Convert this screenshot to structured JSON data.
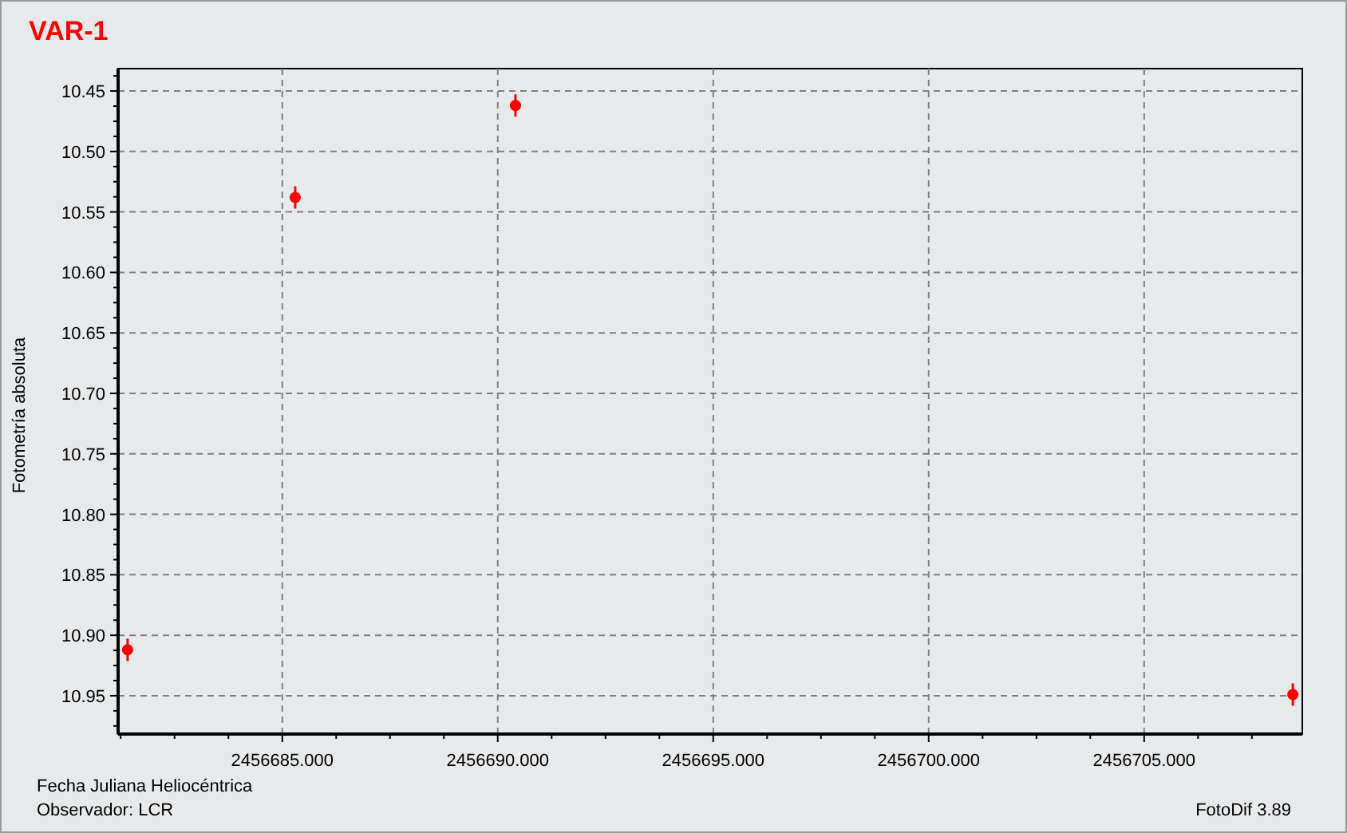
{
  "chart_data": {
    "type": "scatter",
    "grid": true,
    "title": "VAR-1",
    "xlabel": "Fecha Juliana Heliocéntrica",
    "ylabel": "Fotometría absoluta",
    "x": [
      2456681.41,
      2456685.3,
      2456690.41,
      2456708.45
    ],
    "values": [
      10.912,
      10.538,
      10.462,
      10.949
    ],
    "xlim": [
      2456681.19,
      2456708.67
    ],
    "ylim": [
      10.9817,
      10.4315
    ],
    "xticks": [
      {
        "value": 2456685,
        "label": "2456685.000"
      },
      {
        "value": 2456690,
        "label": "2456690.000"
      },
      {
        "value": 2456695,
        "label": "2456695.000"
      },
      {
        "value": 2456700,
        "label": "2456700.000"
      },
      {
        "value": 2456705,
        "label": "2456705.000"
      }
    ],
    "yticks": [
      {
        "value": 10.45,
        "label": "10.45"
      },
      {
        "value": 10.5,
        "label": "10.50"
      },
      {
        "value": 10.55,
        "label": "10.55"
      },
      {
        "value": 10.6,
        "label": "10.60"
      },
      {
        "value": 10.65,
        "label": "10.65"
      },
      {
        "value": 10.7,
        "label": "10.70"
      },
      {
        "value": 10.75,
        "label": "10.75"
      },
      {
        "value": 10.8,
        "label": "10.80"
      },
      {
        "value": 10.85,
        "label": "10.85"
      },
      {
        "value": 10.9,
        "label": "10.90"
      },
      {
        "value": 10.95,
        "label": "10.95"
      }
    ]
  },
  "observer": "Observador: LCR",
  "version": "FotoDif 3.89"
}
